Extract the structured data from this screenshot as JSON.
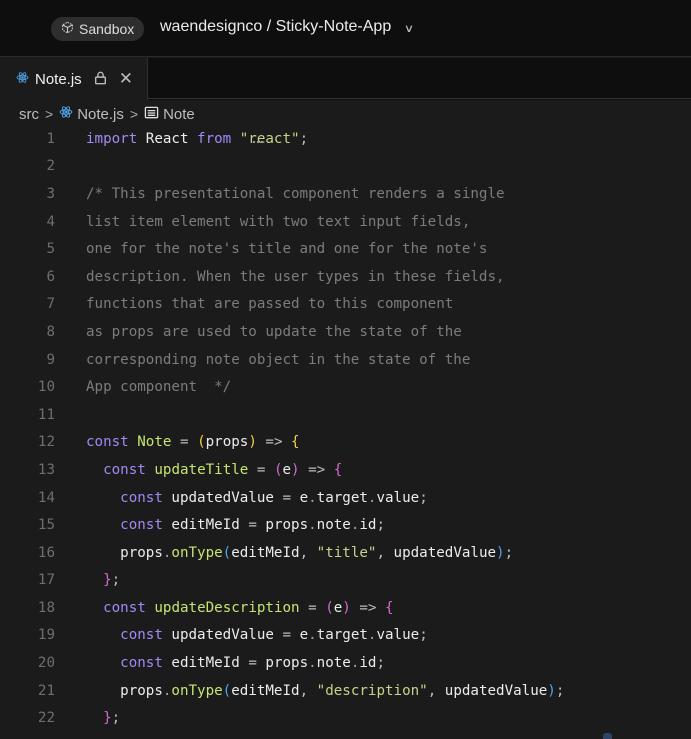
{
  "topbar": {
    "sandbox_label": "Sandbox",
    "sandbox_icon": "cube-icon",
    "repo_title": "waendesignco / Sticky-Note-App",
    "dropdown_icon": "chevron-down-icon"
  },
  "tab": {
    "file_name": "Note.js",
    "file_icon": "react-icon",
    "lock_icon": "lock-icon",
    "close_label": "✕"
  },
  "breadcrumb": {
    "items": [
      "src",
      "Note.js",
      "Note"
    ],
    "separator": ">"
  },
  "editor": {
    "line_numbers": [
      "1",
      "2",
      "3",
      "4",
      "5",
      "6",
      "7",
      "8",
      "9",
      "10",
      "11",
      "12",
      "13",
      "14",
      "15",
      "16",
      "17",
      "18",
      "19",
      "20",
      "21",
      "22"
    ],
    "lines": [
      [
        {
          "t": "import",
          "c": "kw"
        },
        {
          "t": " React ",
          "c": "id"
        },
        {
          "t": "from",
          "c": "kw"
        },
        {
          "t": " ",
          "c": "id"
        },
        {
          "t": "\"react\"",
          "c": "str"
        },
        {
          "t": ";",
          "c": "op"
        }
      ],
      [],
      [
        {
          "t": "/* This presentational component renders a single",
          "c": "cmt"
        }
      ],
      [
        {
          "t": "list item element with two text input fields,",
          "c": "cmt"
        }
      ],
      [
        {
          "t": "one for the note's title and one for the note's",
          "c": "cmt"
        }
      ],
      [
        {
          "t": "description. When the user types in these fields,",
          "c": "cmt"
        }
      ],
      [
        {
          "t": "functions that are passed to this component",
          "c": "cmt"
        }
      ],
      [
        {
          "t": "as props are used to update the state of the",
          "c": "cmt"
        }
      ],
      [
        {
          "t": "corresponding note object in the state of the",
          "c": "cmt"
        }
      ],
      [
        {
          "t": "App component  */",
          "c": "cmt"
        }
      ],
      [],
      [
        {
          "t": "const",
          "c": "kw"
        },
        {
          "t": " ",
          "c": "id"
        },
        {
          "t": "Note",
          "c": "fn"
        },
        {
          "t": " = ",
          "c": "op"
        },
        {
          "t": "(",
          "c": "p1"
        },
        {
          "t": "props",
          "c": "id"
        },
        {
          "t": ")",
          "c": "p1"
        },
        {
          "t": " => ",
          "c": "op"
        },
        {
          "t": "{",
          "c": "p1"
        }
      ],
      [
        {
          "t": "  ",
          "c": "id"
        },
        {
          "t": "const",
          "c": "kw"
        },
        {
          "t": " ",
          "c": "id"
        },
        {
          "t": "updateTitle",
          "c": "fn"
        },
        {
          "t": " = ",
          "c": "op"
        },
        {
          "t": "(",
          "c": "p2"
        },
        {
          "t": "e",
          "c": "id"
        },
        {
          "t": ")",
          "c": "p2"
        },
        {
          "t": " => ",
          "c": "op"
        },
        {
          "t": "{",
          "c": "p2"
        }
      ],
      [
        {
          "t": "    ",
          "c": "id"
        },
        {
          "t": "const",
          "c": "kw"
        },
        {
          "t": " updatedValue ",
          "c": "id"
        },
        {
          "t": "=",
          "c": "op"
        },
        {
          "t": " e",
          "c": "id"
        },
        {
          "t": ".",
          "c": "dot"
        },
        {
          "t": "target",
          "c": "prop"
        },
        {
          "t": ".",
          "c": "dot"
        },
        {
          "t": "value",
          "c": "prop"
        },
        {
          "t": ";",
          "c": "op"
        }
      ],
      [
        {
          "t": "    ",
          "c": "id"
        },
        {
          "t": "const",
          "c": "kw"
        },
        {
          "t": " editMeId ",
          "c": "id"
        },
        {
          "t": "=",
          "c": "op"
        },
        {
          "t": " props",
          "c": "id"
        },
        {
          "t": ".",
          "c": "dot"
        },
        {
          "t": "note",
          "c": "prop"
        },
        {
          "t": ".",
          "c": "dot"
        },
        {
          "t": "id",
          "c": "prop"
        },
        {
          "t": ";",
          "c": "op"
        }
      ],
      [
        {
          "t": "    props",
          "c": "id"
        },
        {
          "t": ".",
          "c": "dot"
        },
        {
          "t": "onType",
          "c": "meth"
        },
        {
          "t": "(",
          "c": "p3"
        },
        {
          "t": "editMeId",
          "c": "id"
        },
        {
          "t": ", ",
          "c": "op"
        },
        {
          "t": "\"title\"",
          "c": "str"
        },
        {
          "t": ", ",
          "c": "op"
        },
        {
          "t": "updatedValue",
          "c": "id"
        },
        {
          "t": ")",
          "c": "p3"
        },
        {
          "t": ";",
          "c": "op"
        }
      ],
      [
        {
          "t": "  ",
          "c": "id"
        },
        {
          "t": "}",
          "c": "p2"
        },
        {
          "t": ";",
          "c": "op"
        }
      ],
      [
        {
          "t": "  ",
          "c": "id"
        },
        {
          "t": "const",
          "c": "kw"
        },
        {
          "t": " ",
          "c": "id"
        },
        {
          "t": "updateDescription",
          "c": "fn"
        },
        {
          "t": " = ",
          "c": "op"
        },
        {
          "t": "(",
          "c": "p2"
        },
        {
          "t": "e",
          "c": "id"
        },
        {
          "t": ")",
          "c": "p2"
        },
        {
          "t": " => ",
          "c": "op"
        },
        {
          "t": "{",
          "c": "p2"
        }
      ],
      [
        {
          "t": "    ",
          "c": "id"
        },
        {
          "t": "const",
          "c": "kw"
        },
        {
          "t": " updatedValue ",
          "c": "id"
        },
        {
          "t": "=",
          "c": "op"
        },
        {
          "t": " e",
          "c": "id"
        },
        {
          "t": ".",
          "c": "dot"
        },
        {
          "t": "target",
          "c": "prop"
        },
        {
          "t": ".",
          "c": "dot"
        },
        {
          "t": "value",
          "c": "prop"
        },
        {
          "t": ";",
          "c": "op"
        }
      ],
      [
        {
          "t": "    ",
          "c": "id"
        },
        {
          "t": "const",
          "c": "kw"
        },
        {
          "t": " editMeId ",
          "c": "id"
        },
        {
          "t": "=",
          "c": "op"
        },
        {
          "t": " props",
          "c": "id"
        },
        {
          "t": ".",
          "c": "dot"
        },
        {
          "t": "note",
          "c": "prop"
        },
        {
          "t": ".",
          "c": "dot"
        },
        {
          "t": "id",
          "c": "prop"
        },
        {
          "t": ";",
          "c": "op"
        }
      ],
      [
        {
          "t": "    props",
          "c": "id"
        },
        {
          "t": ".",
          "c": "dot"
        },
        {
          "t": "onType",
          "c": "meth"
        },
        {
          "t": "(",
          "c": "p3"
        },
        {
          "t": "editMeId",
          "c": "id"
        },
        {
          "t": ", ",
          "c": "op"
        },
        {
          "t": "\"description\"",
          "c": "str"
        },
        {
          "t": ", ",
          "c": "op"
        },
        {
          "t": "updatedValue",
          "c": "id"
        },
        {
          "t": ")",
          "c": "p3"
        },
        {
          "t": ";",
          "c": "op"
        }
      ],
      [
        {
          "t": "  ",
          "c": "id"
        },
        {
          "t": "}",
          "c": "p2"
        },
        {
          "t": ";",
          "c": "op"
        }
      ]
    ]
  },
  "colors": {
    "background": "#1b1b1b",
    "topbar": "#0e0e0e",
    "keyword": "#a389f4",
    "string": "#c3d58a",
    "comment": "#7c7c7c",
    "function": "#c6e570",
    "accent_react": "#4fa3e8"
  }
}
